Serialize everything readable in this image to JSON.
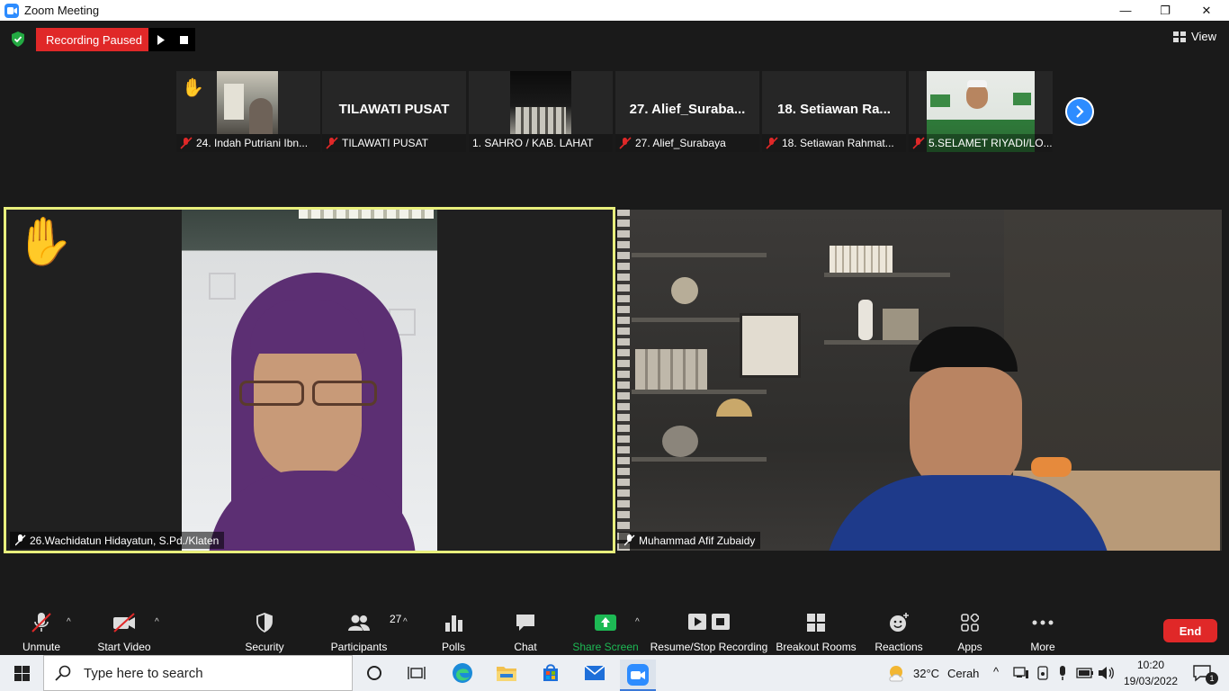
{
  "window": {
    "title": "Zoom Meeting",
    "minimize": "—",
    "maximize": "❐",
    "close": "✕"
  },
  "topbar": {
    "recording_status": "Recording Paused",
    "view_label": "View"
  },
  "filmstrip": [
    {
      "name": "24. Indah Putriani Ibn...",
      "big_name": "",
      "raised_hand": true,
      "has_video": true
    },
    {
      "name": "TILAWATI PUSAT",
      "big_name": "TILAWATI PUSAT",
      "raised_hand": false,
      "has_video": false
    },
    {
      "name": "1.  SAHRO / KAB. LAHAT",
      "big_name": "",
      "raised_hand": false,
      "has_video": true
    },
    {
      "name": "27. Alief_Surabaya",
      "big_name": "27.  Alief_Suraba...",
      "raised_hand": false,
      "has_video": false
    },
    {
      "name": "18. Setiawan Rahmat...",
      "big_name": "18.  Setiawan  Ra...",
      "raised_hand": false,
      "has_video": false
    },
    {
      "name": "5.SELAMET RIYADI/LO...",
      "big_name": "",
      "raised_hand": false,
      "has_video": true
    }
  ],
  "main_videos": {
    "left_name": "26.Wachidatun Hidayatun, S.Pd./Klaten",
    "right_name": "Muhammad Afif Zubaidy"
  },
  "toolbar": {
    "unmute": "Unmute",
    "start_video": "Start Video",
    "security": "Security",
    "participants": "Participants",
    "participants_count": "27",
    "polls": "Polls",
    "chat": "Chat",
    "share_screen": "Share Screen",
    "resume_stop_recording": "Resume/Stop Recording",
    "breakout_rooms": "Breakout Rooms",
    "reactions": "Reactions",
    "apps": "Apps",
    "more": "More",
    "end": "End"
  },
  "taskbar": {
    "search_placeholder": "Type here to search",
    "weather_temp": "32°C",
    "weather_desc": "Cerah",
    "time": "10:20",
    "date": "19/03/2022",
    "notification_count": "1"
  },
  "colors": {
    "zoom_blue": "#2d8cff",
    "record_red": "#e02828",
    "active_speaker_border": "#e8ef7c",
    "share_green": "#1db954"
  }
}
